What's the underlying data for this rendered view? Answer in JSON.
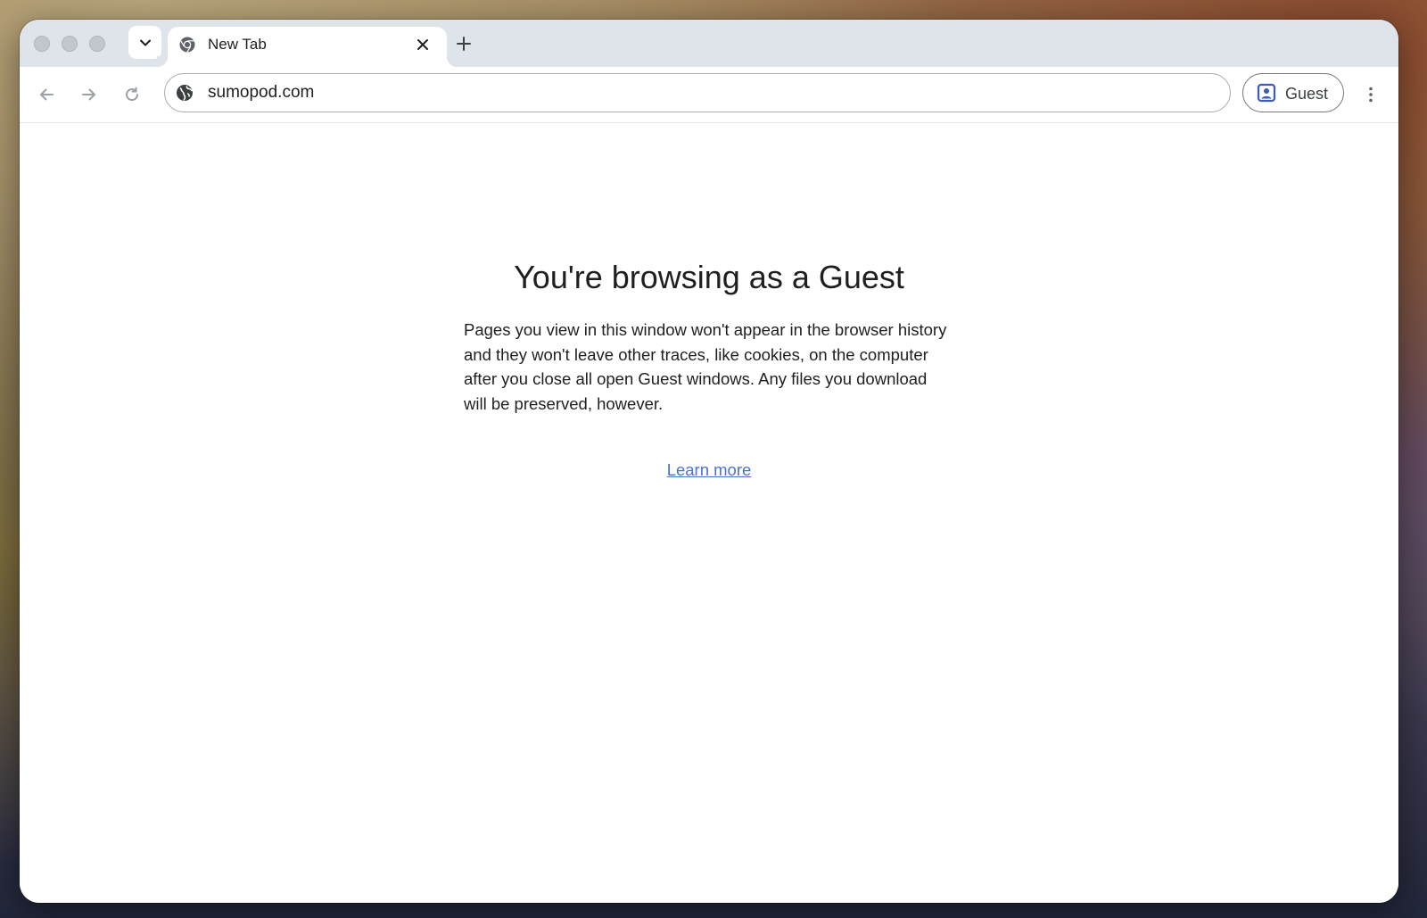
{
  "browser": {
    "tab": {
      "title": "New Tab",
      "favicon": "chrome-icon"
    },
    "omnibox": {
      "url": "sumopod.com",
      "site_icon": "globe-icon"
    },
    "profile": {
      "label": "Guest",
      "icon": "guest-profile-icon"
    },
    "icons": {
      "tab_search": "chevron-down-icon",
      "tab_close": "close-icon",
      "new_tab": "plus-icon",
      "back": "arrow-left-icon",
      "forward": "arrow-right-icon",
      "reload": "reload-icon",
      "menu": "more-vert-icon"
    }
  },
  "page": {
    "heading": "You're browsing as a Guest",
    "description": "Pages you view in this window won't appear in the browser history and they won't leave other traces, like cookies, on the computer after you close all open Guest windows. Any files you download will be preserved, however.",
    "learn_more": "Learn more"
  },
  "colors": {
    "link": "#4a72d1",
    "tabstrip": "#dfe3ea",
    "profile_icon": "#3b5bb5"
  }
}
